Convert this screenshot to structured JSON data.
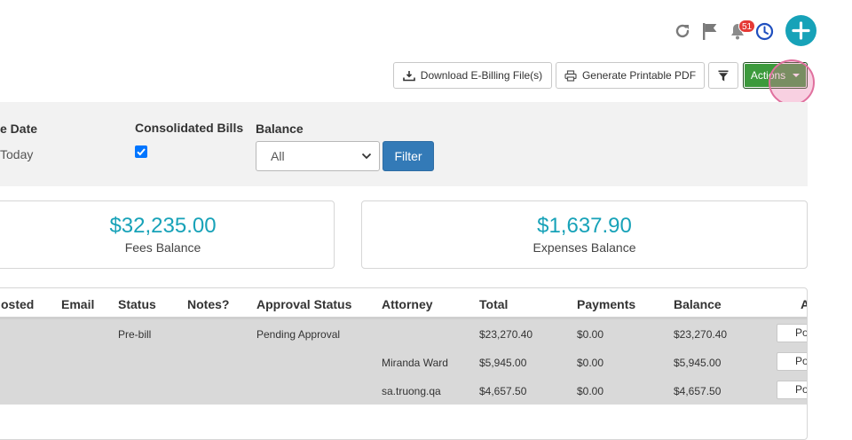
{
  "header": {
    "notification_count": "51"
  },
  "toolbar": {
    "download_ebilling_label": "Download E-Billing File(s)",
    "generate_pdf_label": "Generate Printable PDF",
    "actions_label": "Actions"
  },
  "filters": {
    "date_label": "e Date",
    "date_value": "Today",
    "consolidated_label": "Consolidated Bills",
    "consolidated_checked": true,
    "balance_label": "Balance",
    "balance_selected": "All",
    "filter_button": "Filter"
  },
  "cards": {
    "fees_amount": "$32,235.00",
    "fees_label": "Fees Balance",
    "expenses_amount": "$1,637.90",
    "expenses_label": "Expenses Balance"
  },
  "table": {
    "headers": {
      "posted": "osted",
      "email": "Email",
      "status": "Status",
      "notes": "Notes?",
      "approval": "Approval Status",
      "attorney": "Attorney",
      "total": "Total",
      "payments": "Payments",
      "balance": "Balance",
      "actions": "A"
    },
    "rows": [
      {
        "status": "Pre-bill",
        "approval": "Pending Approval",
        "attorney": "",
        "total": "$23,270.40",
        "payments": "$0.00",
        "balance": "$23,270.40",
        "action": "Po"
      },
      {
        "status": "",
        "approval": "",
        "attorney": "Miranda Ward",
        "total": "$5,945.00",
        "payments": "$0.00",
        "balance": "$5,945.00",
        "action": "Po"
      },
      {
        "status": "",
        "approval": "",
        "attorney": "sa.truong.qa",
        "total": "$4,657.50",
        "payments": "$0.00",
        "balance": "$4,657.50",
        "action": "Po"
      }
    ]
  },
  "colors": {
    "accent_teal": "#17a2b8",
    "primary_blue": "#337ab7",
    "actions_green": "#3c9a3c",
    "badge_red": "#e53935"
  },
  "icons": [
    "refresh-icon",
    "flag-icon",
    "bell-icon",
    "clock-icon",
    "plus-icon",
    "download-icon",
    "printer-icon",
    "filter-icon",
    "chevron-down-icon",
    "check-icon"
  ]
}
